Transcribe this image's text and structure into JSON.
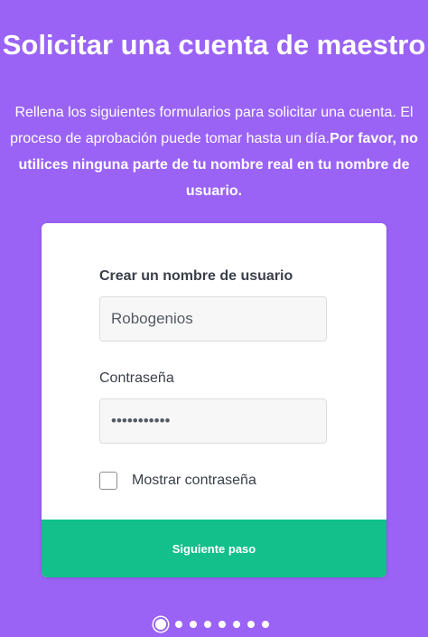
{
  "header": {
    "title": "Solicitar una cuenta de maestro",
    "intro_regular": "Rellena los siguientes formularios para solicitar una cuenta. El proceso de aprobación puede tomar hasta un día.",
    "intro_bold": "Por favor, no utilices ninguna parte de tu nombre real en tu nombre de usuario."
  },
  "form": {
    "username_label": "Crear un nombre de usuario",
    "username_value": "Robogenios",
    "password_label": "Contraseña",
    "password_value": "robogenios1",
    "show_password_label": "Mostrar contraseña",
    "show_password_checked": false,
    "next_button_label": "Siguiente paso"
  },
  "pagination": {
    "total_steps": 8,
    "current_step": 1
  },
  "colors": {
    "background": "#9a63f6",
    "button": "#13bf8b"
  }
}
